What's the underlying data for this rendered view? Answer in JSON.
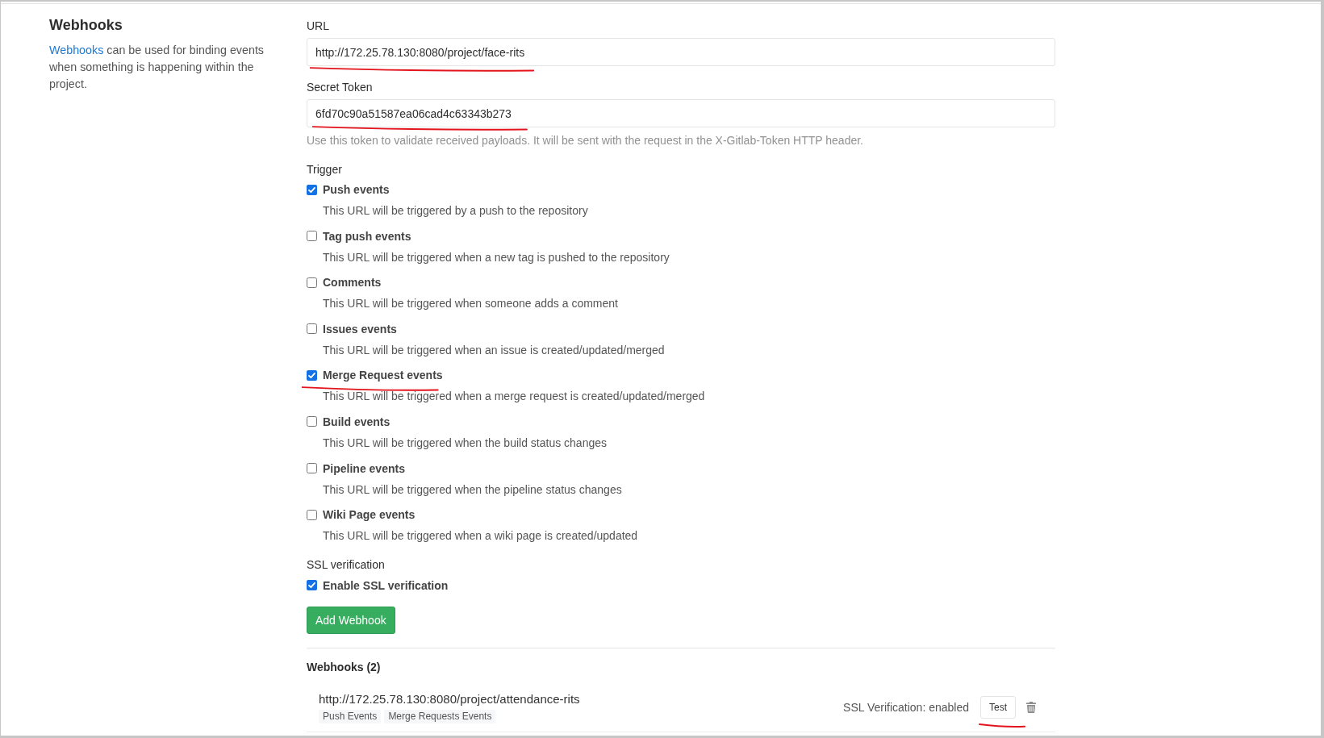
{
  "sidebar": {
    "title": "Webhooks",
    "link": "Webhooks",
    "description": "can be used for binding events when something is happening within the project."
  },
  "url_field": {
    "label": "URL",
    "value": "http://172.25.78.130:8080/project/face-rits",
    "underlined": true
  },
  "token_field": {
    "label": "Secret Token",
    "value": "6fd70c90a51587ea06cad4c63343b273",
    "underlined": true,
    "help": "Use this token to validate received payloads. It will be sent with the request in the X-Gitlab-Token HTTP header."
  },
  "trigger": {
    "label": "Trigger",
    "options": [
      {
        "label": "Push events",
        "description": "This URL will be triggered by a push to the repository",
        "checked": true,
        "underlined": false
      },
      {
        "label": "Tag push events",
        "description": "This URL will be triggered when a new tag is pushed to the repository",
        "checked": false,
        "underlined": false
      },
      {
        "label": "Comments",
        "description": "This URL will be triggered when someone adds a comment",
        "checked": false,
        "underlined": false
      },
      {
        "label": "Issues events",
        "description": "This URL will be triggered when an issue is created/updated/merged",
        "checked": false,
        "underlined": false
      },
      {
        "label": "Merge Request events",
        "description": "This URL will be triggered when a merge request is created/updated/merged",
        "checked": true,
        "underlined": true
      },
      {
        "label": "Build events",
        "description": "This URL will be triggered when the build status changes",
        "checked": false,
        "underlined": false
      },
      {
        "label": "Pipeline events",
        "description": "This URL will be triggered when the pipeline status changes",
        "checked": false,
        "underlined": false
      },
      {
        "label": "Wiki Page events",
        "description": "This URL will be triggered when a wiki page is created/updated",
        "checked": false,
        "underlined": false
      }
    ]
  },
  "ssl": {
    "label": "SSL verification",
    "option": {
      "label": "Enable SSL verification",
      "checked": true
    }
  },
  "add_button": "Add Webhook",
  "webhooks": {
    "title": "Webhooks (2)",
    "items": [
      {
        "url": "http://172.25.78.130:8080/project/attendance-rits",
        "events": [
          "Push Events",
          "Merge Requests Events"
        ],
        "ssl_status": "SSL Verification: enabled",
        "test_button": {
          "label": "Test",
          "underlined": true
        }
      }
    ]
  }
}
